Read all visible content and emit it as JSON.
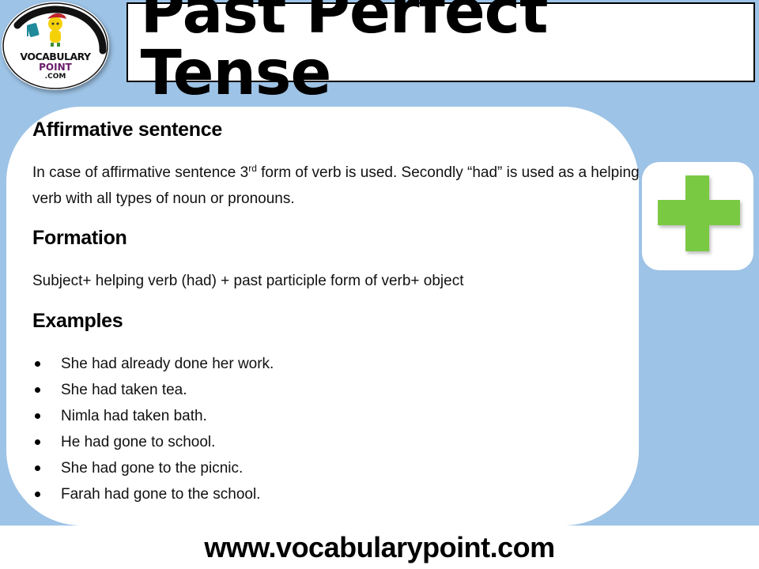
{
  "header": {
    "title": "Past Perfect Tense",
    "logo": {
      "line1": "VOCABULARY",
      "line2": "POINT",
      "line3": ".COM",
      "icon": "vocabulary-point-mascot-logo"
    }
  },
  "sections": {
    "affirmative": {
      "heading": "Affirmative sentence",
      "text_part1": "In case of affirmative sentence 3",
      "superscript": "rd",
      "text_part2": " form of verb is used. Secondly “had” is used as a helping verb with all types of noun or pronouns."
    },
    "formation": {
      "heading": "Formation",
      "text": "Subject+ helping verb (had) + past participle form of verb+ object"
    },
    "examples": {
      "heading": "Examples",
      "items": [
        "She had already done her work.",
        "She had taken tea.",
        "Nimla had taken bath.",
        "He had gone to school.",
        "She had gone to the picnic.",
        "Farah had gone to the school."
      ]
    }
  },
  "side_icon": {
    "name": "plus-icon",
    "color": "#7ac943"
  },
  "footer": {
    "url": "www.vocabularypoint.com"
  },
  "colors": {
    "background_blue": "#9dc3e6",
    "panel": "#ffffff",
    "text": "#000000",
    "logo_point": "#6a1b6a"
  }
}
